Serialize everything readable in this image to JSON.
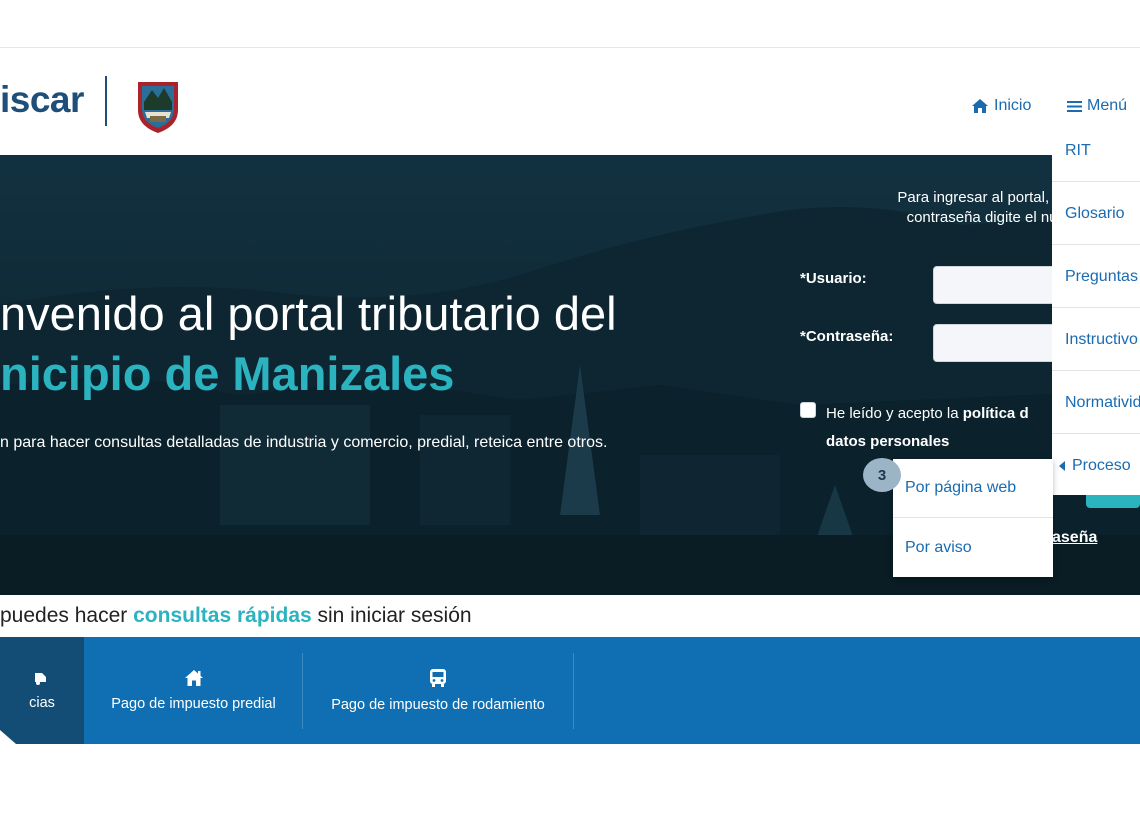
{
  "header": {
    "logo_text": "iscar",
    "nav": {
      "home_label": "Inicio",
      "menu_label": "Menú"
    }
  },
  "hero": {
    "title_line1": "nvenido al portal tributario del",
    "title_line2": "nicipio de Manizales",
    "subtitle": "n para hacer consultas detalladas de industria y comercio, predial, reteica entre otros."
  },
  "login": {
    "intro_line1": "Para ingresar al portal, en",
    "intro_line2": "contraseña digite el núm",
    "user_label": "*Usuario:",
    "password_label": "*Contraseña:",
    "policy_prefix": "He leído y acepto la ",
    "policy_bold": "política d",
    "policy_bold2": "datos personales",
    "recover_link": "aseña"
  },
  "menu": {
    "items": [
      "RIT",
      "Glosario",
      "Preguntas",
      "Instructivo",
      "Normativid",
      "Proceso"
    ],
    "submenu": [
      "Por página web",
      "Por aviso"
    ],
    "badge": "3"
  },
  "quick": {
    "heading_prefix": " puedes hacer ",
    "heading_accent": "consultas rápidas",
    "heading_suffix": " sin iniciar sesión",
    "items": [
      {
        "label": "cias",
        "icon": "car-icon"
      },
      {
        "label": "Pago de impuesto predial",
        "icon": "home-icon"
      },
      {
        "label": "Pago de impuesto de rodamiento",
        "icon": "bus-icon"
      }
    ]
  },
  "colors": {
    "brand_blue": "#1a6bb0",
    "accent_teal": "#2bb3c0",
    "bar_blue": "#0f6fb2",
    "hero_dark": "#0e2530"
  }
}
